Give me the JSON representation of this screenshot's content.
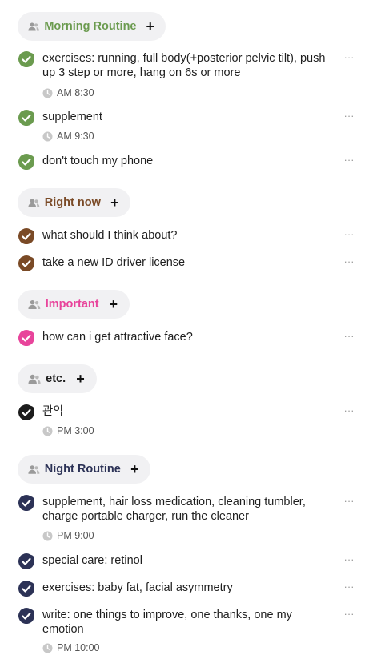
{
  "groups": [
    {
      "name": "Morning Routine",
      "color": "#6b9b4f",
      "tasks": [
        {
          "text": "exercises: running, full body(+posterior pelvic tilt), push up 3 step or more, hang on 6s or more",
          "time": "AM 8:30"
        },
        {
          "text": "supplement",
          "time": "AM 9:30"
        },
        {
          "text": "don't touch my phone",
          "time": ""
        }
      ]
    },
    {
      "name": "Right now",
      "color": "#7a4a26",
      "tasks": [
        {
          "text": "what should I think about?",
          "time": ""
        },
        {
          "text": "take a new ID driver license",
          "time": ""
        }
      ]
    },
    {
      "name": "Important",
      "color": "#e8449b",
      "tasks": [
        {
          "text": "how can i get attractive face?",
          "time": ""
        }
      ]
    },
    {
      "name": "etc.",
      "color": "#1c1c1c",
      "tasks": [
        {
          "text": "관악",
          "time": "PM 3:00"
        }
      ]
    },
    {
      "name": "Night Routine",
      "color": "#2c3256",
      "tasks": [
        {
          "text": "supplement, hair loss medication, cleaning tumbler, charge portable charger, run the cleaner",
          "time": "PM 9:00"
        },
        {
          "text": "special care: retinol",
          "time": ""
        },
        {
          "text": "exercises: baby fat, facial asymmetry",
          "time": ""
        },
        {
          "text": "write: one things to improve, one thanks, one my emotion",
          "time": "PM 10:00"
        }
      ]
    }
  ],
  "ui": {
    "add_symbol": "+",
    "more_symbol": "···"
  }
}
